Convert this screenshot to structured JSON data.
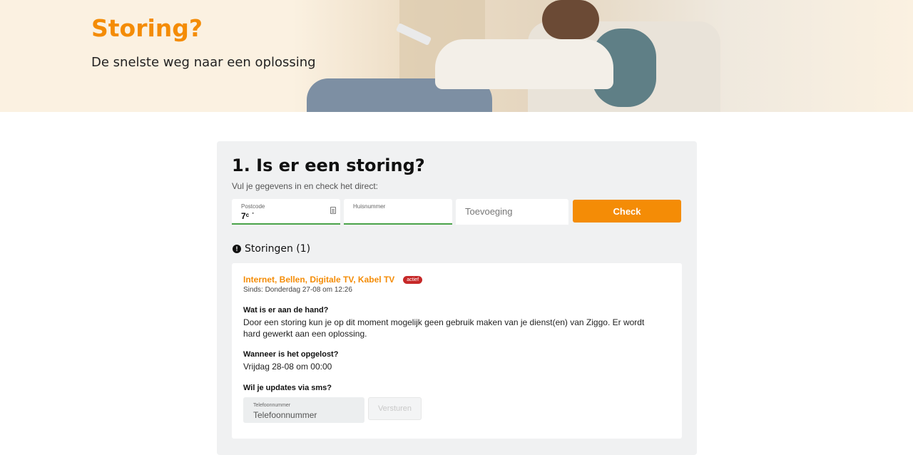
{
  "hero": {
    "title": "Storing?",
    "subtitle": "De snelste weg naar een oplossing"
  },
  "check": {
    "title": "1. Is er een storing?",
    "subtitle": "Vul je gegevens in en check het direct:",
    "postcode": {
      "label": "Postcode",
      "value": "7ᶜ ˙"
    },
    "huisnummer": {
      "label": "Huisnummer",
      "value": ""
    },
    "toevoeging": {
      "placeholder": "Toevoeging"
    },
    "button_label": "Check"
  },
  "storingen": {
    "label": "Storingen (1)",
    "items": [
      {
        "services": "Internet, Bellen, Digitale TV, Kabel TV",
        "status_badge": "actief",
        "since": "Sinds: Donderdag 27-08 om 12:26",
        "q1": "Wat is er aan de hand?",
        "a1": "Door een storing kun je op dit moment mogelijk geen gebruik maken van je dienst(en) van Ziggo. Er wordt hard gewerkt aan een oplossing.",
        "q2": "Wanneer is het opgelost?",
        "a2": "Vrijdag 28-08 om 00:00",
        "q3": "Wil je updates via sms?",
        "phone_label": "Telefoonnummer",
        "phone_placeholder": "Telefoonnummer",
        "send_label": "Versturen"
      }
    ]
  },
  "colors": {
    "accent": "#f48c06",
    "success": "#4aa34a",
    "badge": "#c62828"
  }
}
